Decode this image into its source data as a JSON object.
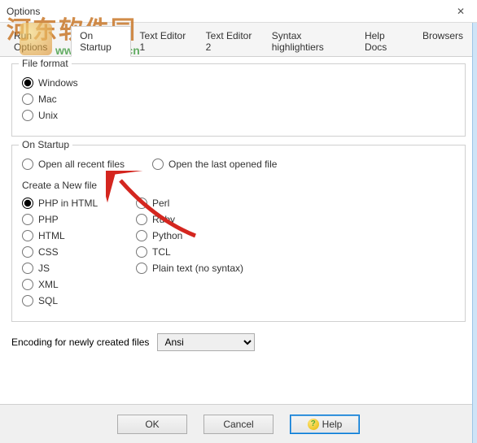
{
  "window": {
    "title": "Options",
    "close": "✕"
  },
  "tabs": {
    "run_options": "Run Options",
    "on_startup": "On Startup",
    "text_editor_1": "Text Editor 1",
    "text_editor_2": "Text Editor 2",
    "syntax": "Syntax highlightiers",
    "help_docs": "Help Docs",
    "browsers": "Browsers"
  },
  "file_format": {
    "legend": "File format",
    "windows": "Windows",
    "mac": "Mac",
    "unix": "Unix"
  },
  "on_startup": {
    "legend": "On Startup",
    "open_all_recent": "Open all recent files",
    "open_last": "Open the last opened file",
    "create_new": "Create a New file",
    "options_left": {
      "php_in_html": "PHP in HTML",
      "php": "PHP",
      "html": "HTML",
      "css": "CSS",
      "js": "JS",
      "xml": "XML",
      "sql": "SQL"
    },
    "options_right": {
      "perl": "Perl",
      "ruby": "Ruby",
      "python": "Python",
      "tcl": "TCL",
      "plain": "Plain text (no syntax)"
    }
  },
  "encoding": {
    "label": "Encoding for newly created files",
    "value": "Ansi"
  },
  "buttons": {
    "ok": "OK",
    "cancel": "Cancel",
    "help": "Help"
  },
  "watermark": {
    "line1": "河东软件园",
    "line2": "www.pc0359.cn"
  }
}
